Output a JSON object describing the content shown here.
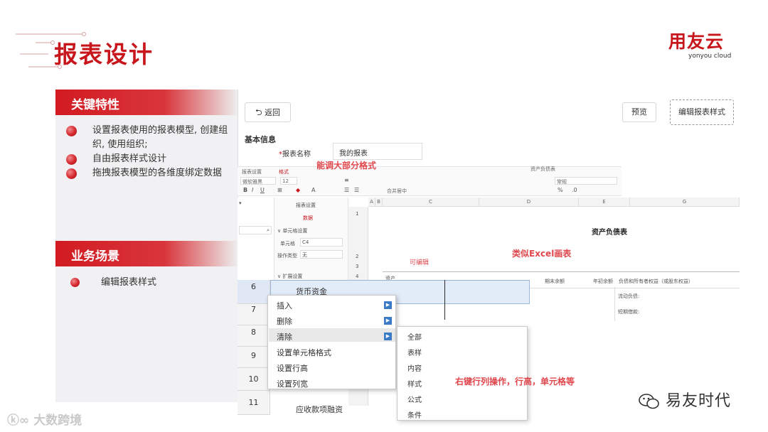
{
  "page_title": "报表设计",
  "logo": {
    "cn": "用友云",
    "en": "yonyou cloud",
    "color": "#c8161d"
  },
  "section_features": {
    "title": "关键特性",
    "items": [
      "设置报表使用的报表模型, 创建组织, 使用组织;",
      "自由报表样式设计",
      "拖拽报表模型的各维度绑定数据"
    ]
  },
  "section_scenarios": {
    "title": "业务场景",
    "items": [
      "编辑报表样式"
    ]
  },
  "app": {
    "back_label": "返回",
    "preview_label": "预览",
    "edit_style_label": "编辑报表样式",
    "basic_info_title": "基本信息",
    "report_name_label": "报表名称",
    "report_name_value": "我的报表",
    "toolbar": {
      "tab1": "报表设置",
      "tab2": "格式",
      "font": "微软雅黑",
      "size": "12",
      "merge": "合并居中",
      "number_format": "常规",
      "sheet_name": "资产负债表"
    },
    "panel": {
      "title": "报表设置",
      "data_label": "数据",
      "cell_group": "单元格设置",
      "cell_label": "单元格",
      "cell_value": "C4",
      "ops_label": "操作类型",
      "ops_value": "无",
      "expand_label": "扩展设置"
    },
    "columns": [
      "A",
      "B",
      "C",
      "D",
      "E",
      "G"
    ],
    "rows_small": [
      "1",
      "2",
      "3",
      "4"
    ],
    "rows_big": [
      "6",
      "7",
      "8",
      "9",
      "10",
      "11"
    ],
    "cells": {
      "report_title": "资产负债表",
      "cash": "货币资金",
      "receivables": "应收款项融资",
      "hdr_assets": "资产",
      "hdr_period": "期末余额",
      "hdr_begin": "年初余额",
      "hdr_liab": "负债和所有者权益（或股东权益）",
      "liab_current": "流动负债:",
      "liab_short": "短期借款:",
      "editable": "可编辑"
    },
    "context_menu": [
      "插入",
      "删除",
      "清除",
      "设置单元格格式",
      "设置行高",
      "设置列宽"
    ],
    "sub_menu": [
      "全部",
      "表样",
      "内容",
      "样式",
      "公式",
      "条件"
    ]
  },
  "annotations": {
    "format": "能调大部分格式",
    "excel": "类似Excel画表",
    "right_click": "右键行列操作，行高，单元格等"
  },
  "footer": {
    "wechat": "易友时代",
    "watermark": "大数跨境"
  },
  "colors": {
    "brand_red": "#c8161d",
    "annotation": "#e0474c",
    "selection": "#e2ecf8",
    "submenu_arrow": "#3b7bc6"
  }
}
